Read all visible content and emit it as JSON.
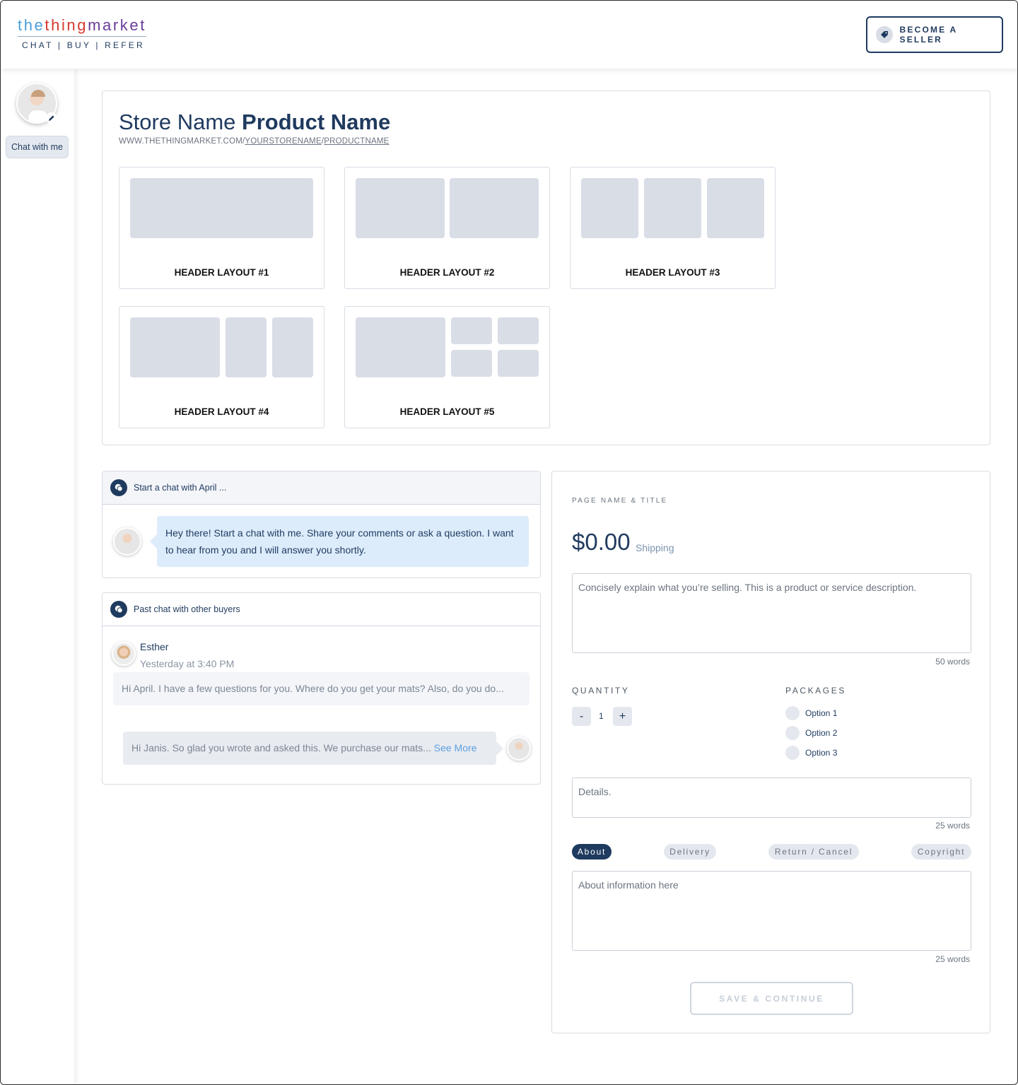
{
  "brand": {
    "logo_part1": "the",
    "logo_part2": "thing",
    "logo_part3": "market",
    "tagline": "CHAT | BUY | REFER",
    "colors": {
      "blue": "#4a9fd8",
      "red": "#d6382f",
      "purple": "#6a3d9a",
      "navy": "#1f3a5f"
    }
  },
  "header": {
    "become_seller_label": "BECOME A SELLER",
    "icon": "price-tag-icon"
  },
  "sidebar": {
    "chat_label": "Chat with me",
    "edit_icon": "pencil-icon"
  },
  "store": {
    "store_name": "Store Name",
    "product_name": "Product Name",
    "url_prefix": "WWW.THETHINGMARKET.COM/",
    "url_store": "YOURSTORENAME",
    "url_sep": "/",
    "url_product": "PRODUCTNAME"
  },
  "layouts": [
    {
      "label": "HEADER LAYOUT #1"
    },
    {
      "label": "HEADER LAYOUT #2"
    },
    {
      "label": "HEADER LAYOUT #3"
    },
    {
      "label": "HEADER LAYOUT #4"
    },
    {
      "label": "HEADER LAYOUT #5"
    }
  ],
  "chat_start": {
    "title": "Start a chat with April ...",
    "message": "Hey there! Start a chat with me. Share your comments or ask a question. I want to hear from you and I will answer you shortly."
  },
  "past_chat": {
    "title": "Past chat with other buyers",
    "buyer_name": "Esther",
    "time": "Yesterday at 3:40 PM",
    "buyer_message": "Hi April. I have a few questions for you. Where do you get your mats? Also, do you do...",
    "reply": "Hi Janis. So glad you wrote and asked this. We purchase our mats...",
    "see_more": "See More"
  },
  "form": {
    "page_name_label": "PAGE NAME & TITLE",
    "price": "$0.00",
    "price_sub": "Shipping",
    "description_placeholder": "Concisely explain what you’re selling. This is a product or service description.",
    "description_count": "50 words",
    "quantity_label": "QUANTITY",
    "quantity_minus": "-",
    "quantity_value": "1",
    "quantity_plus": "+",
    "packages_label": "PACKAGES",
    "packages": [
      "Option 1",
      "Option 2",
      "Option 3"
    ],
    "details_placeholder": "Details.",
    "details_count": "25 words",
    "tabs": [
      "About",
      "Delivery",
      "Return / Cancel",
      "Copyright"
    ],
    "active_tab": "About",
    "about_placeholder": "About information here",
    "about_count": "25 words",
    "save_label": "SAVE & CONTINUE"
  }
}
